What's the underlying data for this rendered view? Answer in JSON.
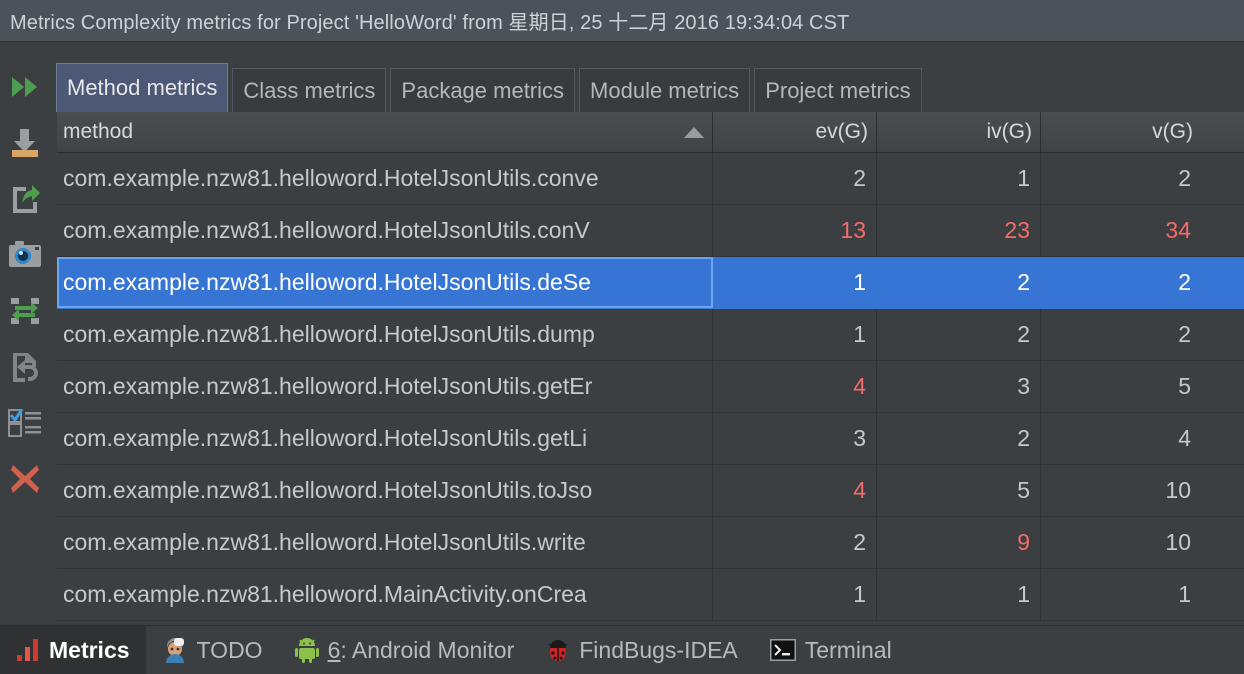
{
  "window": {
    "title": "Metrics Complexity metrics for Project 'HelloWord' from 星期日, 25 十二月 2016 19:34:04 CST"
  },
  "colors": {
    "accent_selection": "#3675d3",
    "warning_text": "#f76a6a",
    "active_tab_bg": "#4c5875",
    "panel_bg": "#3c3f41",
    "titlebar_bg": "#4c5259"
  },
  "toolbar": {
    "items": [
      {
        "name": "run-fast-forward-icon",
        "label": "Run"
      },
      {
        "name": "import-download-icon",
        "label": "Import"
      },
      {
        "name": "export-upload-icon",
        "label": "Export"
      },
      {
        "name": "snapshot-camera-icon",
        "label": "Snapshot"
      },
      {
        "name": "refresh-swap-icon",
        "label": "Refresh"
      },
      {
        "name": "revert-document-icon",
        "label": "Revert"
      },
      {
        "name": "checklist-icon",
        "label": "Select metrics"
      },
      {
        "name": "close-x-icon",
        "label": "Close"
      }
    ]
  },
  "tabs": [
    {
      "label": "Method metrics",
      "active": true
    },
    {
      "label": "Class metrics",
      "active": false
    },
    {
      "label": "Package metrics",
      "active": false
    },
    {
      "label": "Module metrics",
      "active": false
    },
    {
      "label": "Project metrics",
      "active": false
    }
  ],
  "table": {
    "sort": {
      "column": "method",
      "direction": "ascending"
    },
    "columns": [
      {
        "key": "method",
        "label": "method",
        "align": "left"
      },
      {
        "key": "evg",
        "label": "ev(G)",
        "align": "right"
      },
      {
        "key": "ivg",
        "label": "iv(G)",
        "align": "right"
      },
      {
        "key": "vg",
        "label": "v(G)",
        "align": "right"
      }
    ],
    "rows": [
      {
        "method": "com.example.nzw81.helloword.HotelJsonUtils.conve",
        "evg": "2",
        "ivg": "1",
        "vg": "2",
        "evg_warn": false,
        "ivg_warn": false,
        "vg_warn": false,
        "selected": false
      },
      {
        "method": "com.example.nzw81.helloword.HotelJsonUtils.conV",
        "evg": "13",
        "ivg": "23",
        "vg": "34",
        "evg_warn": true,
        "ivg_warn": true,
        "vg_warn": true,
        "selected": false
      },
      {
        "method": "com.example.nzw81.helloword.HotelJsonUtils.deSe",
        "evg": "1",
        "ivg": "2",
        "vg": "2",
        "evg_warn": false,
        "ivg_warn": false,
        "vg_warn": false,
        "selected": true
      },
      {
        "method": "com.example.nzw81.helloword.HotelJsonUtils.dump",
        "evg": "1",
        "ivg": "2",
        "vg": "2",
        "evg_warn": false,
        "ivg_warn": false,
        "vg_warn": false,
        "selected": false
      },
      {
        "method": "com.example.nzw81.helloword.HotelJsonUtils.getEr",
        "evg": "4",
        "ivg": "3",
        "vg": "5",
        "evg_warn": true,
        "ivg_warn": false,
        "vg_warn": false,
        "selected": false
      },
      {
        "method": "com.example.nzw81.helloword.HotelJsonUtils.getLi",
        "evg": "3",
        "ivg": "2",
        "vg": "4",
        "evg_warn": false,
        "ivg_warn": false,
        "vg_warn": false,
        "selected": false
      },
      {
        "method": "com.example.nzw81.helloword.HotelJsonUtils.toJso",
        "evg": "4",
        "ivg": "5",
        "vg": "10",
        "evg_warn": true,
        "ivg_warn": false,
        "vg_warn": false,
        "selected": false
      },
      {
        "method": "com.example.nzw81.helloword.HotelJsonUtils.write",
        "evg": "2",
        "ivg": "9",
        "vg": "10",
        "evg_warn": false,
        "ivg_warn": true,
        "vg_warn": false,
        "selected": false
      },
      {
        "method": "com.example.nzw81.helloword.MainActivity.onCrea",
        "evg": "1",
        "ivg": "1",
        "vg": "1",
        "evg_warn": false,
        "ivg_warn": false,
        "vg_warn": false,
        "selected": false
      }
    ]
  },
  "statusbar": {
    "items": [
      {
        "label": "Metrics",
        "icon": "bar-chart-icon",
        "active": true,
        "mnemonic": ""
      },
      {
        "label": "TODO",
        "icon": "todo-person-icon",
        "active": false,
        "mnemonic": ""
      },
      {
        "label": ": Android Monitor",
        "icon": "android-icon",
        "active": false,
        "mnemonic": "6"
      },
      {
        "label": "FindBugs-IDEA",
        "icon": "ladybug-icon",
        "active": false,
        "mnemonic": ""
      },
      {
        "label": "Terminal",
        "icon": "terminal-icon",
        "active": false,
        "mnemonic": ""
      }
    ]
  }
}
